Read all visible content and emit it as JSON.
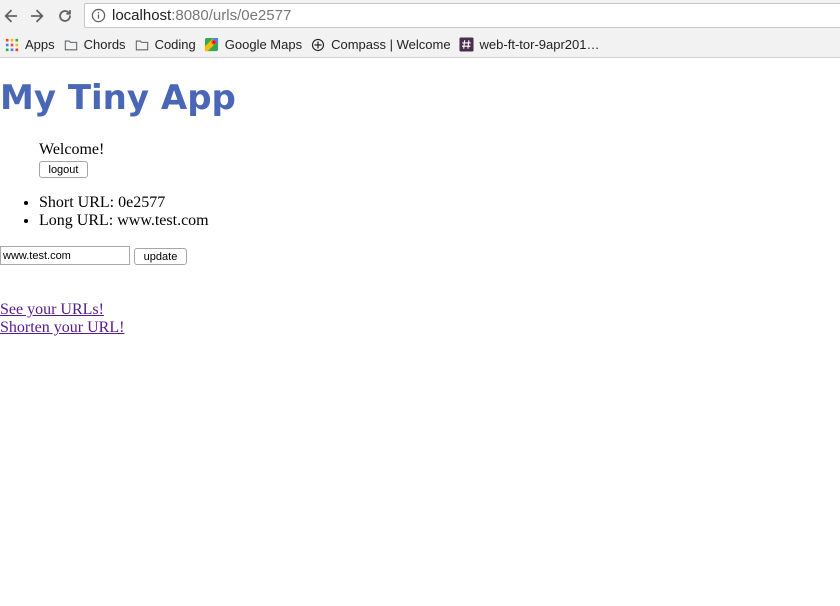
{
  "browser": {
    "url_host": "localhost",
    "url_path": ":8080/urls/0e2577",
    "bookmarks": [
      {
        "label": "Apps",
        "icon": "apps-grid-icon"
      },
      {
        "label": "Chords",
        "icon": "folder-icon"
      },
      {
        "label": "Coding",
        "icon": "folder-icon"
      },
      {
        "label": "Google Maps",
        "icon": "google-maps-icon"
      },
      {
        "label": "Compass | Welcome",
        "icon": "compass-icon"
      },
      {
        "label": "web-ft-tor-9apr201…",
        "icon": "slack-icon"
      }
    ]
  },
  "page": {
    "title": "My Tiny App",
    "welcome": "Welcome!",
    "logout_label": "logout",
    "short_url": "Short URL: 0e2577",
    "long_url": "Long URL: www.test.com",
    "input_value": "www.test.com",
    "update_label": "update",
    "link_see_urls": "See your URLs!",
    "link_shorten": "Shorten your URL!"
  },
  "colors": {
    "title": "#4a67b7",
    "visited_link": "#551a8b",
    "chrome_bg": "#f2f2f2"
  }
}
